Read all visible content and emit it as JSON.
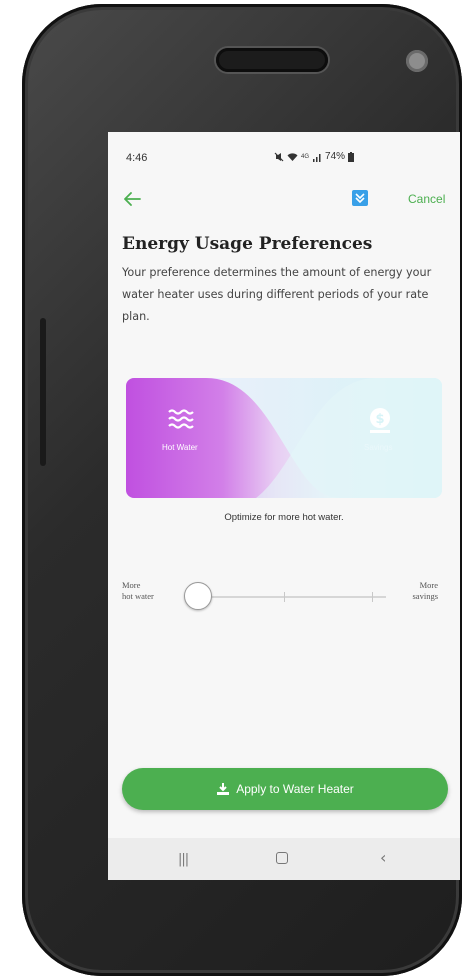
{
  "status_bar": {
    "time": "4:46",
    "icons": [
      "mute-icon",
      "wifi-icon",
      "signal-icon"
    ],
    "network_label": "4G",
    "battery": "74%"
  },
  "header": {
    "back_icon": "arrow-left-icon",
    "menu_icon": "download-menu-icon",
    "cancel_label": "Cancel"
  },
  "page": {
    "title": "Energy Usage Preferences",
    "description": "Your preference determines the amount of energy your water heater uses during different periods of your rate plan."
  },
  "illustration": {
    "left_label": "Hot Water",
    "left_icon": "water-waves-icon",
    "right_label": "Savings",
    "right_icon": "money-coin-icon",
    "colors": {
      "hot_water": "#c45be0",
      "savings": "#d6f3f7"
    }
  },
  "optimize_text": "Optimize for more hot water.",
  "slider": {
    "left_label_line1": "More",
    "left_label_line2": "hot water",
    "right_label_line1": "More",
    "right_label_line2": "savings",
    "value": 0,
    "steps": 3
  },
  "apply_button": {
    "label": "Apply to Water Heater",
    "icon": "download-icon",
    "color": "#4caf50"
  },
  "nav_bar": {
    "recents_icon": "recents-icon",
    "home_icon": "home-icon",
    "back_icon": "back-chevron-icon"
  },
  "accent_color": "#4caf50"
}
